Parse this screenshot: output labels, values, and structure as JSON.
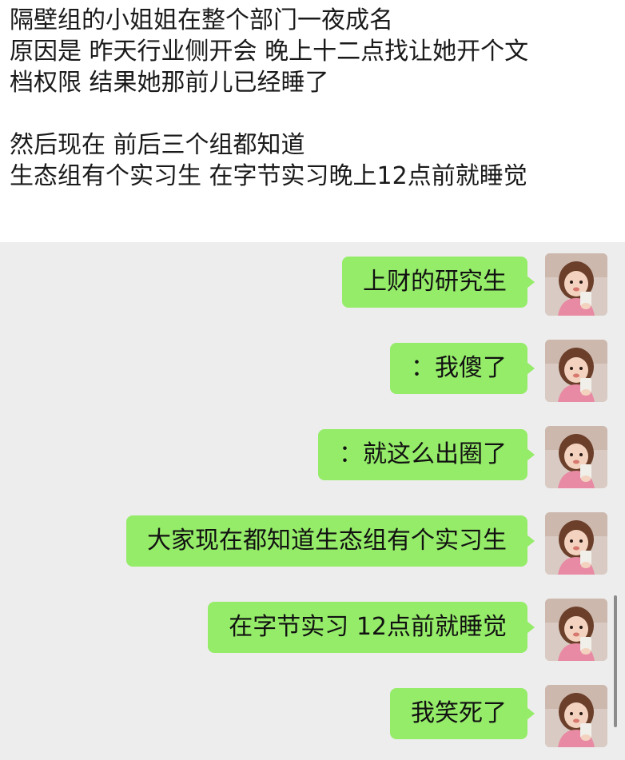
{
  "post": {
    "lines": [
      "隔壁组的小姐姐在整个部门一夜成名",
      "原因是 昨天行业侧开会 晚上十二点找让她开个文",
      "档权限 结果她那前儿已经睡了",
      "",
      "然后现在 前后三个组都知道",
      "生态组有个实习生 在字节实习晚上12点前就睡觉"
    ]
  },
  "chat": {
    "bubble_color": "#95ec69",
    "background_color": "#ededed",
    "messages": [
      {
        "text": "上财的研究生",
        "sender": "self",
        "avatar": "girl-photo-avatar"
      },
      {
        "text": "：我傻了",
        "sender": "self",
        "avatar": "girl-photo-avatar"
      },
      {
        "text": "：就这么出圈了",
        "sender": "self",
        "avatar": "girl-photo-avatar"
      },
      {
        "text": "大家现在都知道生态组有个实习生",
        "sender": "self",
        "avatar": "girl-photo-avatar"
      },
      {
        "text": "在字节实习 12点前就睡觉",
        "sender": "self",
        "avatar": "girl-photo-avatar"
      },
      {
        "text": "我笑死了",
        "sender": "self",
        "avatar": "girl-photo-avatar"
      }
    ]
  }
}
